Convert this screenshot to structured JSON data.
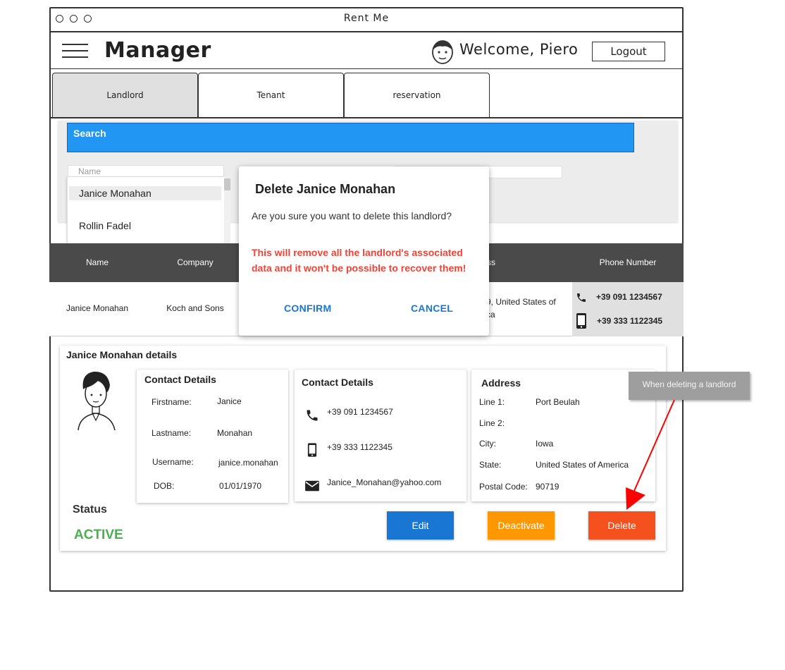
{
  "window": {
    "title": "Rent Me"
  },
  "header": {
    "app_title": "Manager",
    "welcome": "Welcome, Piero",
    "logout_label": "Logout"
  },
  "tabs": [
    {
      "label": "Landlord",
      "active": true
    },
    {
      "label": "Tenant",
      "active": false
    },
    {
      "label": "reservation",
      "active": false
    }
  ],
  "search": {
    "title": "Search",
    "name_placeholder": "Name",
    "suggestions": [
      "Janice Monahan",
      "Rollin Fadel"
    ]
  },
  "table": {
    "columns": [
      "Name",
      "Company",
      "ss",
      "Phone Number"
    ],
    "row": {
      "name": "Janice Monahan",
      "company": "Koch and Sons",
      "address_line1": "9, United States of",
      "address_line2": "ca",
      "phone": "+39 091 1234567",
      "mobile": "+39 333 1122345"
    }
  },
  "details": {
    "title": "Janice Monahan details",
    "contact1": {
      "title": "Contact Details",
      "firstname_label": "Firstname:",
      "firstname": "Janice",
      "lastname_label": "Lastname:",
      "lastname": "Monahan",
      "username_label": "Username:",
      "username": "janice.monahan",
      "dob_label": "DOB:",
      "dob": "01/01/1970"
    },
    "contact2": {
      "title": "Contact Details",
      "phone": "+39 091 1234567",
      "mobile": "+39 333 1122345",
      "email": "Janice_Monahan@yahoo.com"
    },
    "address": {
      "title": "Address",
      "line1_label": "Line 1:",
      "line1": "Port Beulah",
      "line2_label": "Line 2:",
      "line2": "",
      "city_label": "City:",
      "city": "Iowa",
      "state_label": "State:",
      "state": "United States of America",
      "postal_label": "Postal Code:",
      "postal": "90719"
    },
    "status_label": "Status",
    "status_value": "ACTIVE",
    "buttons": {
      "edit": "Edit",
      "deactivate": "Deactivate",
      "delete": "Delete"
    }
  },
  "tooltip": "When deleting a landlord",
  "modal": {
    "title": "Delete Janice Monahan",
    "message": "Are you sure you want to delete this landlord?",
    "warning": "This will remove all the landlord's associated data and it won't be possible to recover them!",
    "confirm": "CONFIRM",
    "cancel": "CANCEL"
  },
  "colors": {
    "search_blue": "#2196f3",
    "edit_blue": "#1976d2",
    "deactivate_orange": "#ff9800",
    "delete_red": "#f4511e",
    "active_green": "#4caf50",
    "warning_red": "#f44336"
  }
}
